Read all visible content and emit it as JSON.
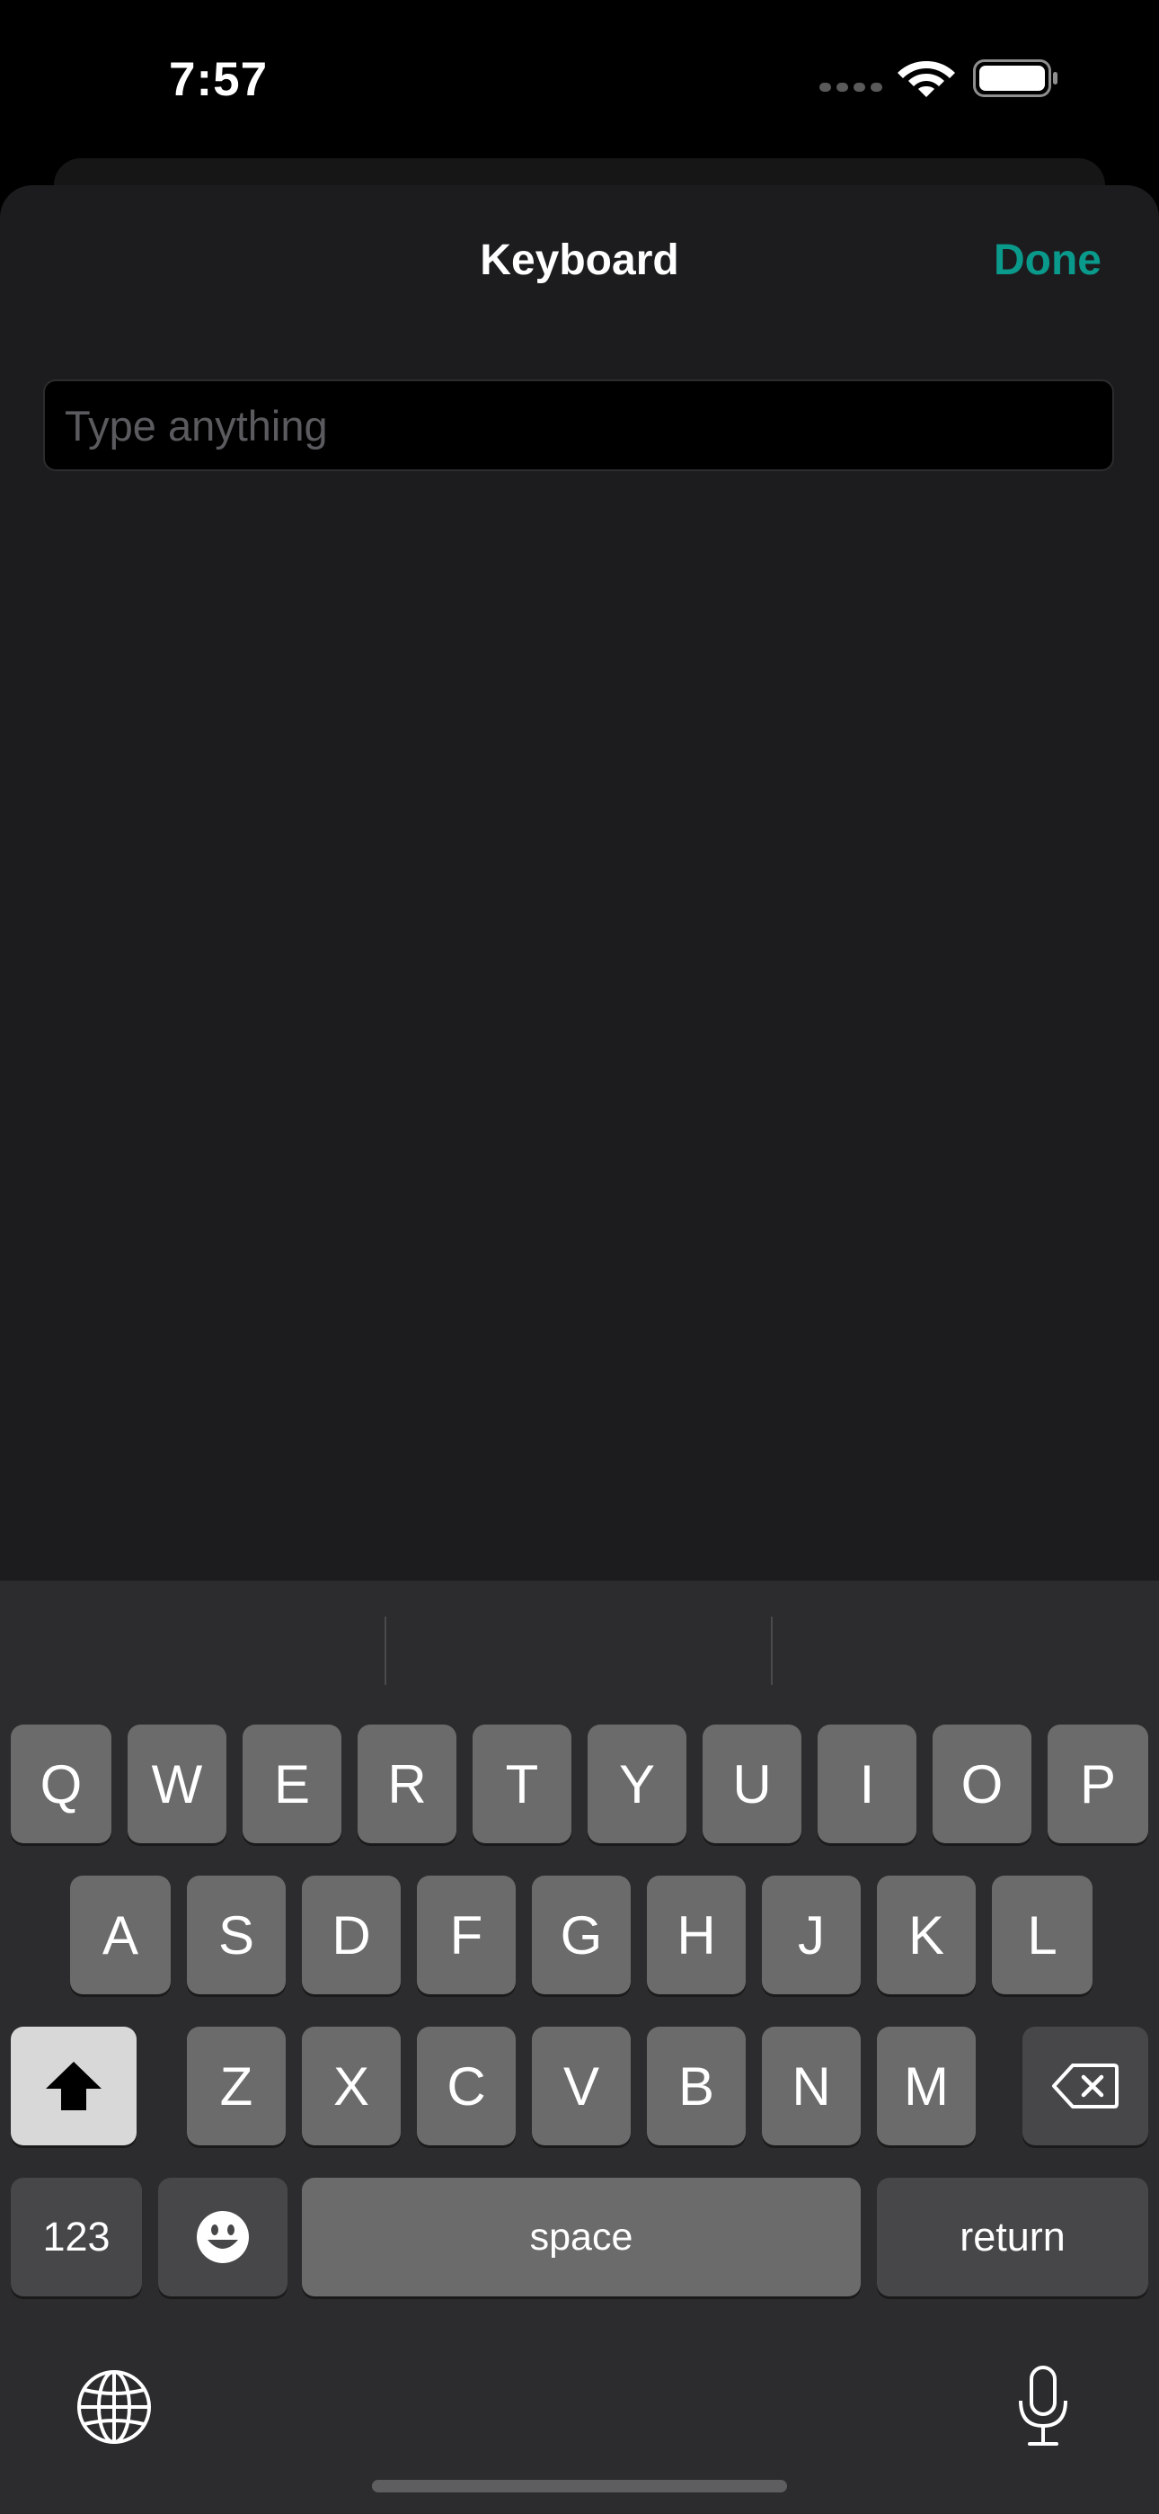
{
  "status_bar": {
    "time": "7:57"
  },
  "sheet": {
    "title": "Keyboard",
    "done_label": "Done",
    "input": {
      "placeholder": "Type anything",
      "value": ""
    }
  },
  "keyboard": {
    "row1": [
      "Q",
      "W",
      "E",
      "R",
      "T",
      "Y",
      "U",
      "I",
      "O",
      "P"
    ],
    "row2": [
      "A",
      "S",
      "D",
      "F",
      "G",
      "H",
      "J",
      "K",
      "L"
    ],
    "row3": [
      "Z",
      "X",
      "C",
      "V",
      "B",
      "N",
      "M"
    ],
    "numbers_label": "123",
    "space_label": "space",
    "return_label": "return"
  },
  "icons": {
    "wifi": "wifi-icon",
    "battery": "battery-icon",
    "shift": "shift-icon",
    "delete": "delete-icon",
    "emoji": "emoji-icon",
    "globe": "globe-icon",
    "mic": "microphone-icon"
  },
  "colors": {
    "accent": "#0a9a8c",
    "sheet": "#1c1c1e",
    "keyboard": "#2c2c2e",
    "key": "#6b6b6b"
  }
}
